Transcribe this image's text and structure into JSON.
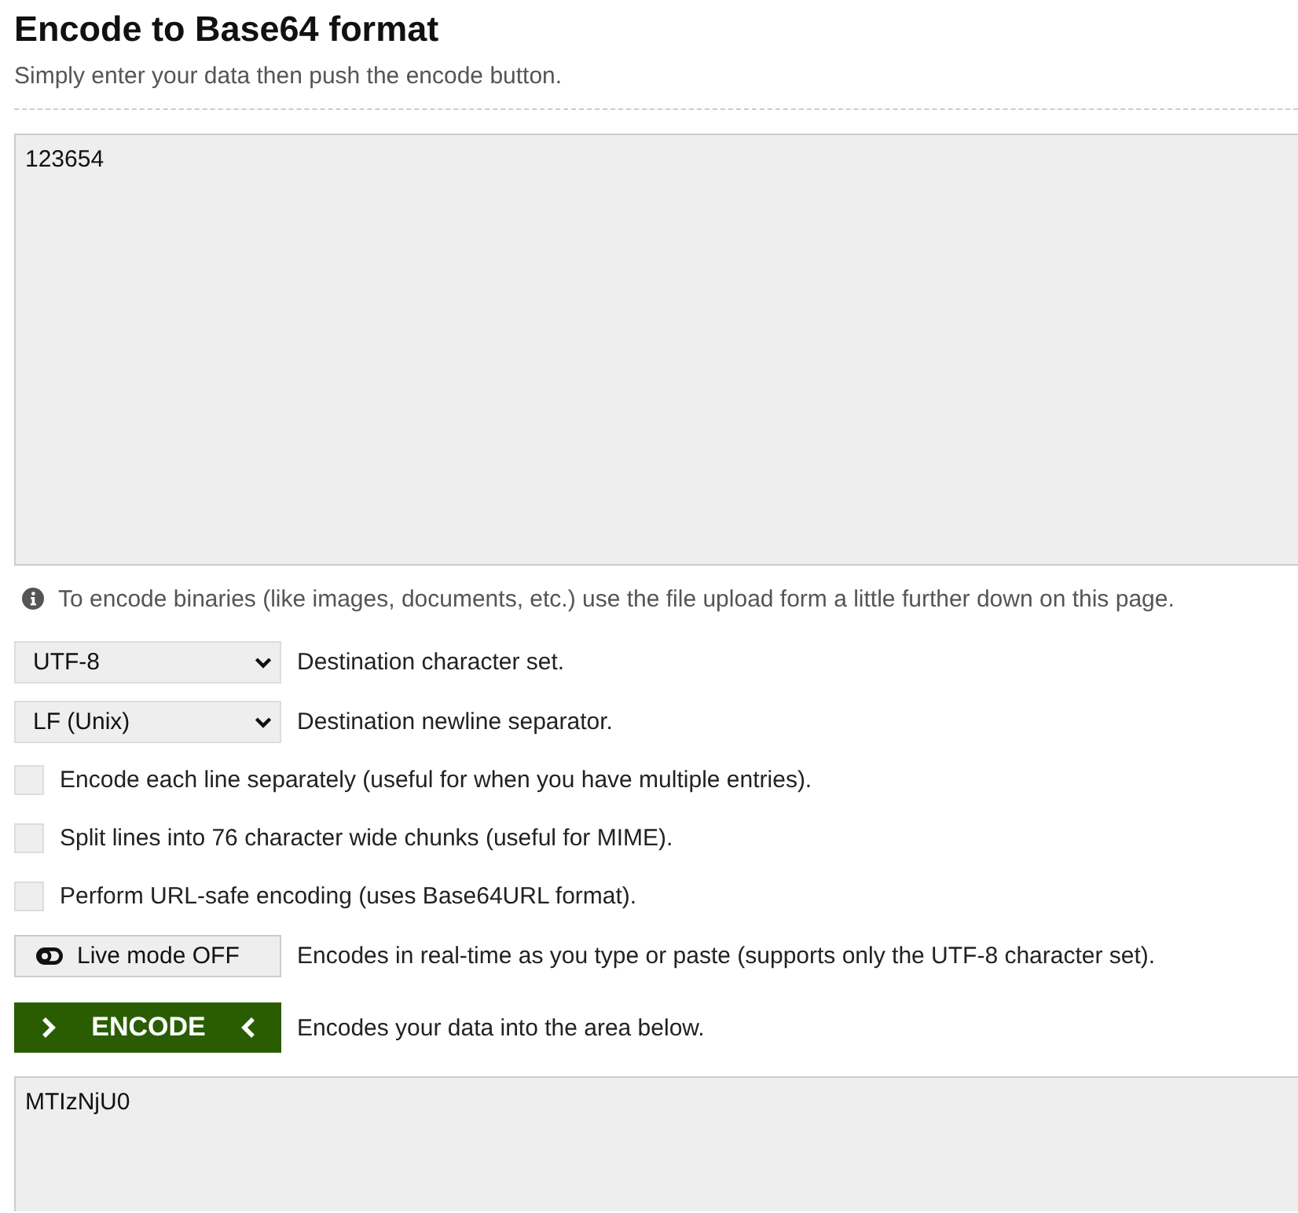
{
  "header": {
    "title": "Encode to Base64 format",
    "subtitle": "Simply enter your data then push the encode button."
  },
  "input": {
    "value": "123654"
  },
  "info_note": "To encode binaries (like images, documents, etc.) use the file upload form a little further down on this page.",
  "selects": [
    {
      "value": "UTF-8",
      "label": "Destination character set."
    },
    {
      "value": "LF (Unix)",
      "label": "Destination newline separator."
    }
  ],
  "options": [
    {
      "label": "Encode each line separately (useful for when you have multiple entries).",
      "checked": false
    },
    {
      "label": "Split lines into 76 character wide chunks (useful for MIME).",
      "checked": false
    },
    {
      "label": "Perform URL-safe encoding (uses Base64URL format).",
      "checked": false
    }
  ],
  "live_mode": {
    "button": "Live mode OFF",
    "on": false,
    "description": "Encodes in real-time as you type or paste (supports only the UTF-8 character set)."
  },
  "encode": {
    "button": "ENCODE",
    "description": "Encodes your data into the area below."
  },
  "output": {
    "value": "MTIzNjU0"
  }
}
